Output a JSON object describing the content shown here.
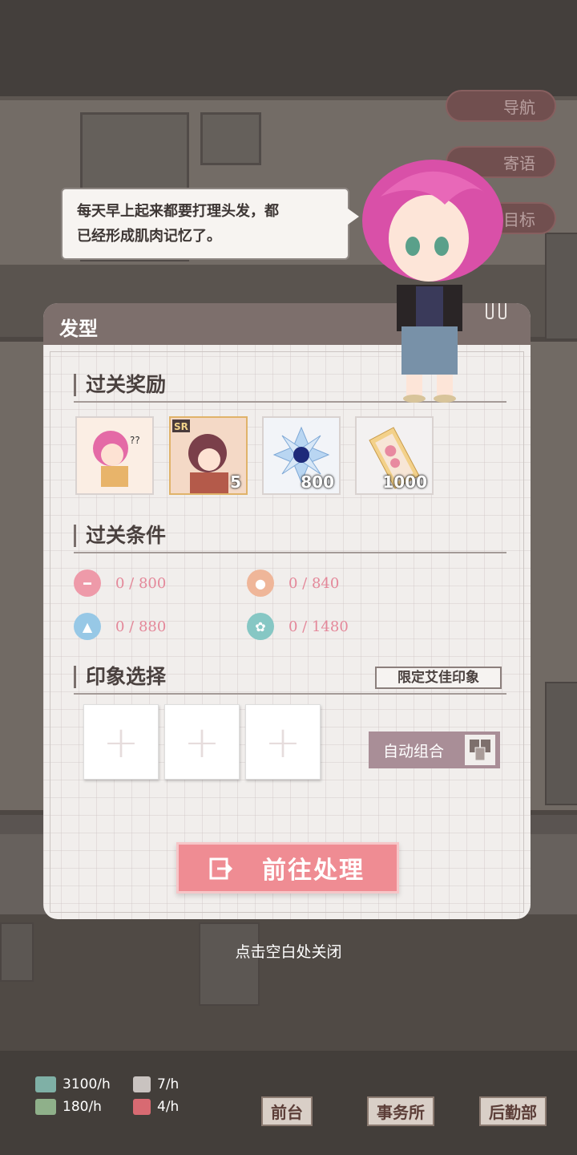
{
  "top_menu": {
    "nav": "导航",
    "message": "寄语",
    "goal": "目标"
  },
  "bubble": {
    "line1": "每天早上起来都要打理头发，都",
    "line2": "已经形成肌肉记忆了。"
  },
  "panel": {
    "title": "发型",
    "rewards": {
      "title": "过关奖励",
      "items": [
        {
          "icon": "character-card-icon",
          "count": ""
        },
        {
          "icon": "sr-card-icon",
          "badge": "SR",
          "count": "5"
        },
        {
          "icon": "blue-flower-gem-icon",
          "count": "800"
        },
        {
          "icon": "bookmark-ticket-icon",
          "count": "1000"
        }
      ]
    },
    "conditions": {
      "title": "过关条件",
      "items": [
        {
          "icon": "dumbbell-icon",
          "color": "#ee9aa9",
          "text": "0 / 800"
        },
        {
          "icon": "person-icon",
          "color": "#efb699",
          "text": "0 / 840"
        },
        {
          "icon": "graduation-cap-icon",
          "color": "#97c8e6",
          "text": "0 / 880"
        },
        {
          "icon": "flower-icon",
          "color": "#86c7c4",
          "text": "0 / 1480"
        }
      ]
    },
    "impression": {
      "title": "印象选择",
      "limit_label": "限定艾佳印象",
      "auto_label": "自动组合",
      "slot_symbol": "+"
    },
    "go_button": "前往处理"
  },
  "close_hint": "点击空白处关闭",
  "bottom": {
    "stats": [
      {
        "icon": "cash-icon",
        "text": "3100/h",
        "color": "#7fb0a6"
      },
      {
        "icon": "book-icon",
        "text": "180/h",
        "color": "#8fb08a"
      },
      {
        "icon": "film-icon",
        "text": "7/h",
        "color": "#c9c3c0"
      },
      {
        "icon": "gift-icon",
        "text": "4/h",
        "color": "#d86a72"
      }
    ],
    "nav": [
      "前台",
      "事务所",
      "后勤部"
    ]
  }
}
